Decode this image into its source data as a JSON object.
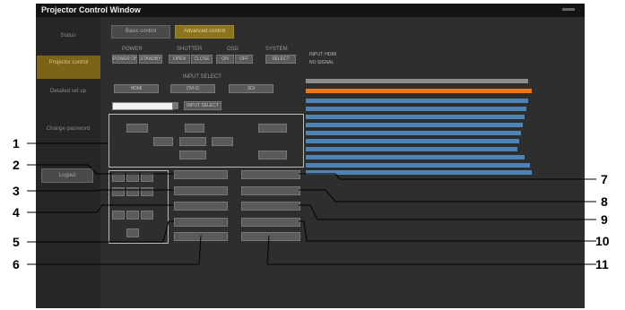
{
  "window": {
    "title": "Projector Control Window"
  },
  "sidebar": {
    "items": [
      {
        "label": "Status"
      },
      {
        "label": "Projector control",
        "active": true
      },
      {
        "label": "Detailed set up"
      },
      {
        "label": "Change password"
      }
    ],
    "button": "Logout"
  },
  "tabs": [
    {
      "label": "Basic control"
    },
    {
      "label": "Advanced control",
      "active": true
    }
  ],
  "groups": {
    "power": "POWER",
    "shutter": "SHUTTER",
    "osd": "OSD",
    "system": "SYSTEM",
    "input_select": "INPUT SELECT"
  },
  "buttons": {
    "power_on": "POWER ON",
    "standby": "STANDBY",
    "shutter_open": "OPEN",
    "shutter_close": "CLOSE",
    "osd_on": "ON",
    "osd_off": "OFF",
    "system": "SELECT",
    "input1": "HDMI",
    "input2": "DVI-D",
    "input3": "SDI",
    "input_select_btn": "INPUT SELECT"
  },
  "status": {
    "line1": "INPUT: HDMI",
    "line2": "NO SIGNAL"
  },
  "callouts": [
    "1",
    "2",
    "3",
    "4",
    "5",
    "6",
    "7",
    "8",
    "9",
    "10",
    "11"
  ],
  "colors": {
    "highlight": "#e8781e",
    "list": "#4f83b6",
    "active_tab": "#8a7420"
  }
}
